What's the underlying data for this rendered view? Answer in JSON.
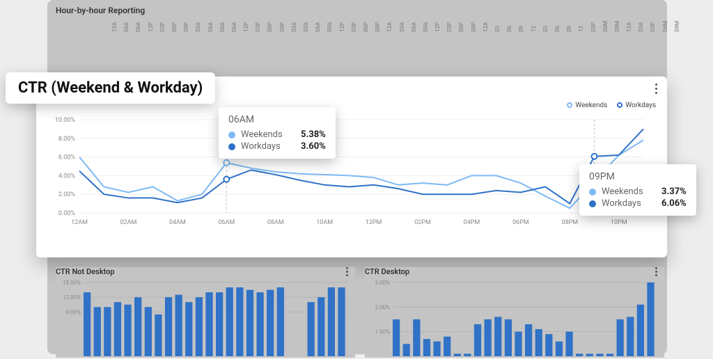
{
  "background": {
    "header": "Hour-by-hour Reporting",
    "hours": [
      "12A",
      "06A",
      "06A",
      "12P",
      "03P",
      "06P",
      "09P",
      "03A",
      "06A",
      "06A",
      "06A",
      "12P",
      "03P",
      "06P",
      "09P",
      "03A",
      "03A",
      "06A",
      "09A",
      "12P",
      "03P",
      "06P",
      "09P",
      "12A",
      "03A",
      "06A",
      "09A",
      "12P",
      "03P",
      "06P",
      "09P",
      "12A",
      "03",
      "06",
      "09",
      "12",
      "03",
      "06",
      "09",
      "12",
      "03P",
      "06M",
      "09M",
      "12A",
      "03A",
      "03P",
      "06M",
      "09M"
    ]
  },
  "main": {
    "title": "CTR (Weekend & Workday)",
    "legend": {
      "s1": "Weekends",
      "s2": "Workdays",
      "c1": "#7eb9f5",
      "c2": "#2f72c7"
    },
    "kebab": "⋮"
  },
  "chart_data": {
    "type": "line",
    "title": "CTR (Weekend & Workday)",
    "xlabel": "",
    "ylabel": "",
    "ylim": [
      0,
      10
    ],
    "ytick_format": "percent",
    "x_ticks": [
      "12AM",
      "02AM",
      "04AM",
      "06AM",
      "08AM",
      "10AM",
      "12PM",
      "02PM",
      "04PM",
      "06PM",
      "08PM",
      "10PM"
    ],
    "categories": [
      "12AM",
      "01AM",
      "02AM",
      "03AM",
      "04AM",
      "05AM",
      "06AM",
      "07AM",
      "08AM",
      "09AM",
      "10AM",
      "11AM",
      "12PM",
      "01PM",
      "02PM",
      "03PM",
      "04PM",
      "05PM",
      "06PM",
      "07PM",
      "08PM",
      "09PM",
      "10PM",
      "11PM"
    ],
    "series": [
      {
        "name": "Weekends",
        "color": "#7eb9f5",
        "values": [
          6.0,
          2.8,
          2.2,
          2.8,
          1.3,
          2.0,
          5.38,
          4.8,
          4.4,
          4.2,
          4.1,
          4.0,
          3.8,
          3.0,
          3.2,
          3.0,
          4.0,
          4.0,
          3.2,
          1.8,
          0.5,
          3.37,
          6.2,
          7.8
        ]
      },
      {
        "name": "Workdays",
        "color": "#2f72c7",
        "values": [
          4.5,
          2.0,
          1.6,
          1.6,
          1.1,
          1.6,
          3.6,
          4.6,
          4.1,
          3.5,
          3.0,
          2.8,
          3.0,
          2.6,
          2.0,
          2.0,
          2.0,
          2.4,
          2.2,
          2.8,
          1.0,
          6.06,
          6.2,
          9.0
        ]
      }
    ]
  },
  "tooltips": {
    "t1": {
      "title": "06AM",
      "rows": [
        {
          "name": "Weekends",
          "value": "5.38%",
          "color": "#7eb9f5"
        },
        {
          "name": "Workdays",
          "value": "3.60%",
          "color": "#2f72c7"
        }
      ]
    },
    "t2": {
      "title": "09PM",
      "rows": [
        {
          "name": "Weekends",
          "value": "3.37%",
          "color": "#7eb9f5"
        },
        {
          "name": "Workdays",
          "value": "6.06%",
          "color": "#2f72c7"
        }
      ]
    }
  },
  "mini1": {
    "title": "CTR Not Desktop",
    "chart_data": {
      "type": "bar",
      "ylim": [
        0,
        15
      ],
      "yticks": [
        9,
        12,
        15
      ],
      "ytick_format": "percent",
      "values": [
        13,
        10,
        10,
        11,
        10.5,
        12,
        10,
        8.5,
        12,
        12.5,
        11,
        12,
        13,
        13,
        14,
        14,
        13.5,
        13,
        13.5,
        14,
        0,
        0,
        11,
        12,
        14,
        14
      ]
    }
  },
  "mini2": {
    "title": "CTR Desktop",
    "chart_data": {
      "type": "bar",
      "ylim": [
        0,
        3
      ],
      "yticks": [
        1,
        2,
        3
      ],
      "ytick_format": "percent",
      "values": [
        1.5,
        0.5,
        1.5,
        0.7,
        0.6,
        0.8,
        0.1,
        0.1,
        1.3,
        1.5,
        1.6,
        1.5,
        1.0,
        1.3,
        1.1,
        0.9,
        0.6,
        1.0,
        0.1,
        0.1,
        0.1,
        0.1,
        1.5,
        1.6,
        2.1,
        3.0
      ]
    }
  }
}
